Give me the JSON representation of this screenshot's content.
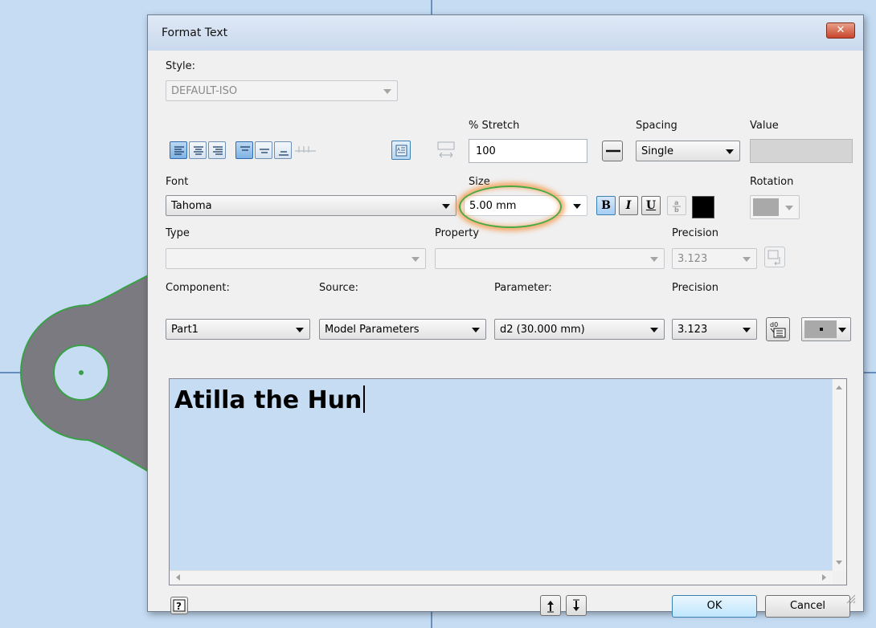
{
  "dialog": {
    "title": "Format Text",
    "close_icon": "close-icon"
  },
  "style": {
    "label": "Style:",
    "value": "DEFAULT-ISO"
  },
  "stretch": {
    "label": "% Stretch",
    "value": "100"
  },
  "spacing": {
    "label": "Spacing",
    "value": "Single"
  },
  "value_field": {
    "label": "Value",
    "value": ""
  },
  "font": {
    "label": "Font",
    "value": "Tahoma"
  },
  "size": {
    "label": "Size",
    "value": "5.00 mm"
  },
  "rotation": {
    "label": "Rotation"
  },
  "formatting": {
    "bold": "B",
    "italic": "I",
    "underline": "U",
    "text_color": "#000000"
  },
  "type_field": {
    "label": "Type",
    "value": ""
  },
  "property": {
    "label": "Property",
    "value": ""
  },
  "precision_top": {
    "label": "Precision",
    "value": "3.123"
  },
  "component": {
    "label": "Component:",
    "value": "Part1"
  },
  "source": {
    "label": "Source:",
    "value": "Model Parameters"
  },
  "parameter": {
    "label": "Parameter:",
    "value": "d2 (30.000 mm)"
  },
  "precision_bottom": {
    "label": "Precision",
    "value": "3.123"
  },
  "editor": {
    "text": "Atilla the Hun",
    "background": "#c5dcf3"
  },
  "buttons": {
    "ok": "OK",
    "cancel": "Cancel"
  },
  "colors": {
    "canvas": "#c5dcf3",
    "part_fill": "#7a7a80",
    "part_edge": "#3aa047",
    "highlight_ring": "#4aa83e",
    "highlight_glow": "#f59b50"
  }
}
